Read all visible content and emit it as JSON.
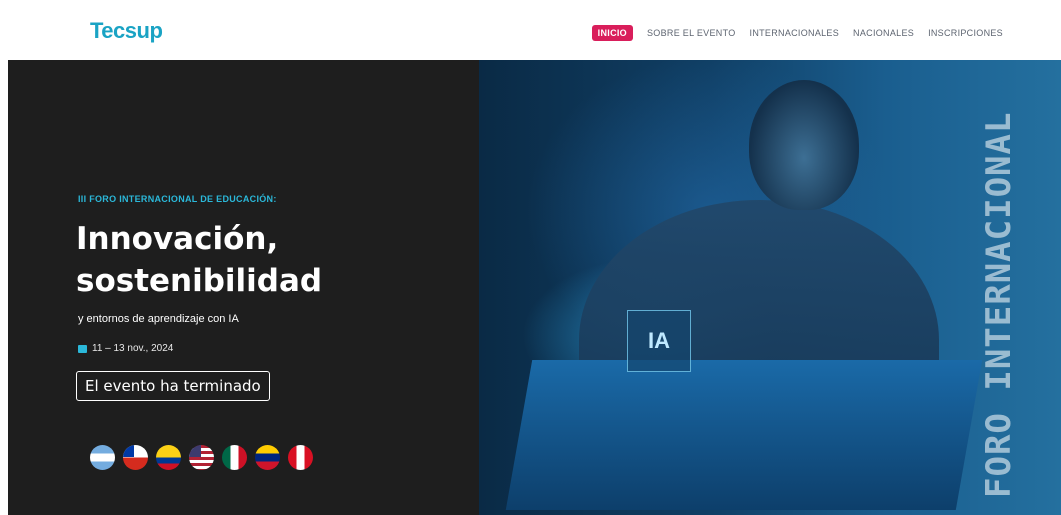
{
  "header": {
    "logo": "Tecsup",
    "nav": [
      "INICIO",
      "SOBRE EL EVENTO",
      "INTERNACIONALES",
      "NACIONALES",
      "INSCRIPCIONES"
    ]
  },
  "hero": {
    "eyebrow": "III FORO INTERNACIONAL DE EDUCACIÓN:",
    "title_line1": "Innovación,",
    "title_line2": "sostenibilidad",
    "subtitle": "y entornos de aprendizaje con IA",
    "date": "11 – 13 nov., 2024",
    "button": "El evento ha terminado",
    "image_label": "IA",
    "vertical_text": "FORO INTERNACIONAL"
  },
  "colors": {
    "accent": "#1aa3c4",
    "active_nav": "#d91e5b",
    "dark_panel": "#1e1e1e"
  },
  "flags": [
    "argentina-flag-icon",
    "chile-flag-icon",
    "colombia-flag-icon",
    "usa-flag-icon",
    "mexico-flag-icon",
    "venezuela-flag-icon",
    "peru-flag-icon"
  ]
}
